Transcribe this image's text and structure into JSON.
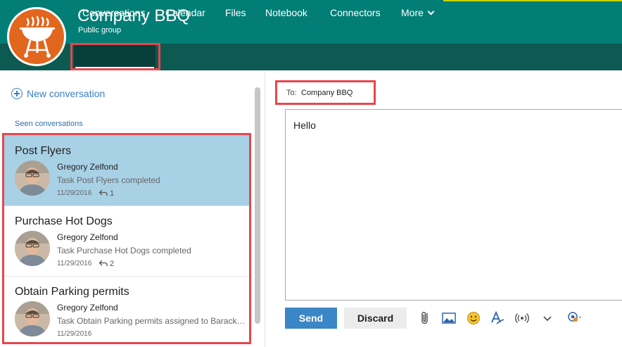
{
  "group": {
    "title": "Company BBQ",
    "subtitle": "Public group",
    "logo_icon": "grill-icon"
  },
  "nav": {
    "items": [
      {
        "label": "Conversations",
        "active": true
      },
      {
        "label": "Calendar"
      },
      {
        "label": "Files"
      },
      {
        "label": "Notebook"
      },
      {
        "label": "Connectors"
      },
      {
        "label": "More"
      }
    ]
  },
  "sidebar": {
    "new_conversation": "New conversation",
    "seen_label": "Seen conversations",
    "conversations": [
      {
        "title": "Post Flyers",
        "author": "Gregory Zelfond",
        "preview": "Task Post Flyers completed",
        "date": "11/29/2016",
        "replies": "1",
        "selected": true
      },
      {
        "title": "Purchase Hot Dogs",
        "author": "Gregory Zelfond",
        "preview": "Task Purchase Hot Dogs completed",
        "date": "11/29/2016",
        "replies": "2",
        "selected": false
      },
      {
        "title": "Obtain Parking permits",
        "author": "Gregory Zelfond",
        "preview": "Task Obtain Parking permits assigned to Barack ...",
        "date": "11/29/2016",
        "replies": "",
        "selected": false
      }
    ]
  },
  "compose": {
    "to_label": "To:",
    "to_value": "Company BBQ",
    "body": "Hello",
    "send_label": "Send",
    "discard_label": "Discard",
    "tools": [
      "attach-icon",
      "image-icon",
      "emoji-icon",
      "format-text-icon",
      "broadcast-icon",
      "chevron-down-icon",
      "mention-icon"
    ]
  },
  "colors": {
    "header": "#027e76",
    "nav": "#0c5a52",
    "accent_blue": "#3b86c6",
    "selected_row": "#a8d1e6",
    "logo_orange": "#e2661e",
    "highlight_red": "#e8464d"
  }
}
